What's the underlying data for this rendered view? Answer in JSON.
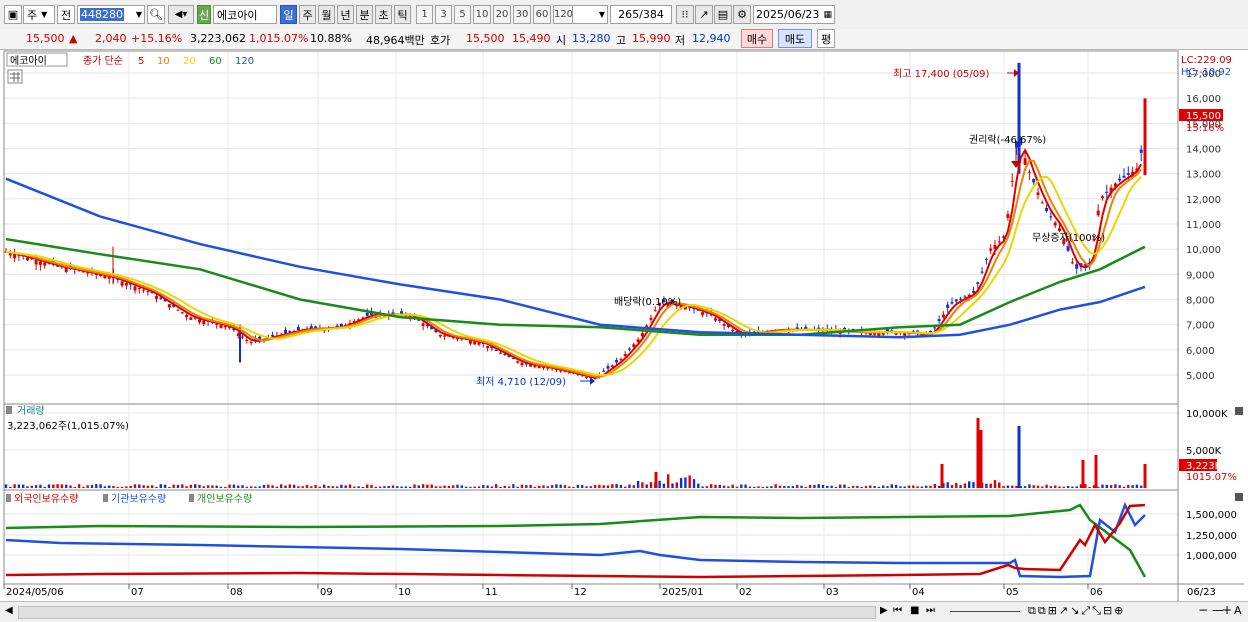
{
  "toolbar": {
    "period_type": "주",
    "prev_label": "전",
    "code": "448280",
    "badge": "신",
    "stock_name": "에코아이",
    "intervals": [
      "일",
      "주",
      "월",
      "년",
      "분",
      "초",
      "틱"
    ],
    "active_interval": "일",
    "numbers": [
      "1",
      "3",
      "5",
      "10",
      "20",
      "30",
      "60",
      "120"
    ],
    "count": "265",
    "total": "/384",
    "date": "2025/06/23"
  },
  "quote": {
    "price": "15,500",
    "arrow": "▲",
    "change": "2,040",
    "change_pct": "+15.16%",
    "volume": "3,223,062",
    "volume_pct": "1,015.07%",
    "turnover_rate": "10.88%",
    "amount": "48,964백만",
    "ask_label": "호가",
    "ask1": "15,500",
    "ask2": "15,490",
    "open_label": "시",
    "open": "13,280",
    "high_label": "고",
    "high": "15,990",
    "low_label": "저",
    "low": "12,940",
    "buy_label": "매수",
    "sell_label": "매도",
    "eval_label": "평"
  },
  "price_panel": {
    "name": "에코아이",
    "legend": "종가 단순",
    "ma_labels": [
      "5",
      "10",
      "20",
      "60",
      "120"
    ],
    "ma_colors": [
      "#e00000",
      "#f08000",
      "#e8d800",
      "#1a8a1a",
      "#2050e0"
    ],
    "lc_label": "LC:229.09",
    "hc_label": "HC:-10.92",
    "price_tag": "15,500",
    "pct_tag": "15.16%",
    "y_ticks": [
      "17,000",
      "16,000",
      "15,000",
      "14,000",
      "13,000",
      "12,000",
      "11,000",
      "10,000",
      "9,000",
      "8,000",
      "7,000",
      "6,000",
      "5,000"
    ],
    "annotations": {
      "high": "최고 17,400 (05/09)",
      "low": "최저 4,710 (12/09)",
      "rights": "권리락(-46.67%)",
      "dividend": "배당락(0.10%)",
      "bonus": "무상증자(100%)"
    }
  },
  "volume_panel": {
    "label": "거래량",
    "value_text": "3,223,062주(1,015.07%)",
    "y_ticks": [
      "10,000K",
      "5,000K"
    ],
    "tag": "3,223K",
    "pct_tag": "1015.07%"
  },
  "holdings_panel": {
    "labels": [
      "외국인보유수량",
      "기관보유수량",
      "개인보유수량"
    ],
    "colors": [
      "#d00000",
      "#2050e0",
      "#1a8a1a"
    ],
    "y_ticks": [
      "1,500,000",
      "1,250,000",
      "1,000,000"
    ]
  },
  "x_axis": {
    "labels": [
      "2024/05/06",
      "07",
      "08",
      "09",
      "10",
      "11",
      "12",
      "2025/01",
      "02",
      "03",
      "04",
      "05",
      "06"
    ],
    "end_label": "06/23"
  },
  "chart_data": {
    "type": "line",
    "title": "에코아이 종가 단순",
    "x": [
      "2024/05",
      "2024/06",
      "2024/07",
      "2024/08",
      "2024/09",
      "2024/10",
      "2024/11",
      "2024/12",
      "2025/01",
      "2025/02",
      "2025/03",
      "2025/04",
      "2025/05",
      "2025/06",
      "2025/06/23"
    ],
    "series": [
      {
        "name": "5",
        "values": [
          9800,
          9100,
          8100,
          6600,
          6900,
          7400,
          6200,
          4900,
          7600,
          6900,
          6700,
          6700,
          12800,
          9800,
          13400
        ]
      },
      {
        "name": "120",
        "values": [
          12800,
          11000,
          9400,
          8600,
          8200,
          7800,
          7300,
          6500,
          6300,
          6300,
          6400,
          6600,
          7200,
          7800,
          8500
        ]
      }
    ],
    "volume_bar_max_K": 10000,
    "ylim": [
      4500,
      17500
    ]
  }
}
